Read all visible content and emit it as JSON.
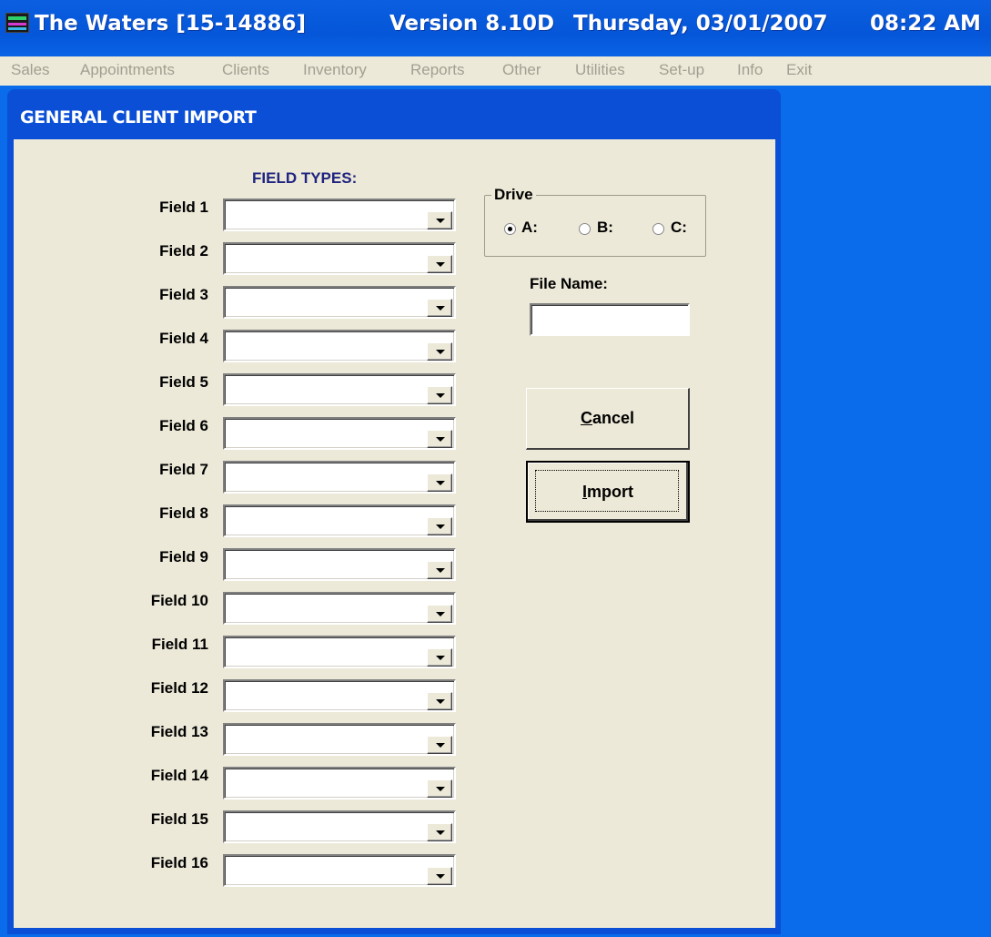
{
  "titlebar": {
    "app_name": "The Waters [15-14886]",
    "version": "Version 8.10D",
    "date": "Thursday, 03/01/2007",
    "time": "08:22 AM"
  },
  "menu": {
    "items": [
      "Sales",
      "Appointments",
      "Clients",
      "Inventory",
      "Reports",
      "Other",
      "Utilities",
      "Set-up",
      "Info",
      "Exit"
    ]
  },
  "dialog": {
    "title": "GENERAL CLIENT IMPORT",
    "field_types_header": "FIELD TYPES:",
    "fields": [
      {
        "label": "Field 1",
        "value": ""
      },
      {
        "label": "Field 2",
        "value": ""
      },
      {
        "label": "Field 3",
        "value": ""
      },
      {
        "label": "Field 4",
        "value": ""
      },
      {
        "label": "Field 5",
        "value": ""
      },
      {
        "label": "Field 6",
        "value": ""
      },
      {
        "label": "Field 7",
        "value": ""
      },
      {
        "label": "Field 8",
        "value": ""
      },
      {
        "label": "Field 9",
        "value": ""
      },
      {
        "label": "Field 10",
        "value": ""
      },
      {
        "label": "Field 11",
        "value": ""
      },
      {
        "label": "Field 12",
        "value": ""
      },
      {
        "label": "Field 13",
        "value": ""
      },
      {
        "label": "Field 14",
        "value": ""
      },
      {
        "label": "Field 15",
        "value": ""
      },
      {
        "label": "Field 16",
        "value": ""
      }
    ],
    "drive": {
      "legend": "Drive",
      "options": [
        "A:",
        "B:",
        "C:"
      ],
      "selected": "A:"
    },
    "file_name": {
      "label": "File Name:",
      "value": ""
    },
    "cancel_button": {
      "accel": "C",
      "rest": "ancel"
    },
    "import_button": {
      "accel": "I",
      "rest": "mport"
    }
  },
  "colors": {
    "desktop_blue": "#0A6CEB",
    "dialog_face": "#ECE9D8",
    "header_navy": "#1F2480",
    "menu_disabled": "#A19F92"
  }
}
